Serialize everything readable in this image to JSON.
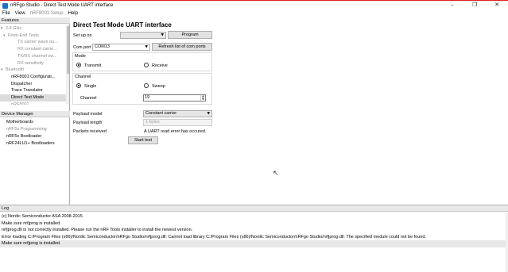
{
  "window": {
    "title": "nRFgo Studio - Direct Test Mode UART interface",
    "controls": [
      "–",
      "❐",
      "✕"
    ]
  },
  "menu": {
    "file": "File",
    "view": "View",
    "setup": "nRF8001 Setup",
    "help": "Help"
  },
  "features": {
    "header": "Features",
    "items": [
      {
        "label": "2.4 GHz",
        "expander": "▾"
      },
      {
        "label": "Front-End Tests",
        "expander": "▾"
      },
      {
        "label": "TX carrier wave ou..."
      },
      {
        "label": "RX constant carrie..."
      },
      {
        "label": "TX/RX channel sw..."
      },
      {
        "label": "RX sensitivity"
      },
      {
        "label": "Bluetooth",
        "expander": "▾"
      },
      {
        "label": "nRF8001 Configurati..."
      },
      {
        "label": "Dispatcher"
      },
      {
        "label": "Trace Translator"
      },
      {
        "label": "Direct Test Mode"
      },
      {
        "label": "nRF8002..."
      }
    ]
  },
  "device_manager": {
    "header": "Device Manager",
    "items": [
      {
        "label": "Motherboards"
      },
      {
        "label": "nRF5x Programming"
      },
      {
        "label": "nRF5x Bootloader"
      },
      {
        "label": "nRF24LU1+ Bootloaders"
      }
    ]
  },
  "dtm": {
    "title": "Direct Test Mode UART interface",
    "setup_label": "Set up on",
    "setup_value": "",
    "program_button": "Program",
    "com_port_label": "Com port",
    "com_port_value": "COM13",
    "refresh_button": "Refresh list of com ports",
    "mode_label": "Mode",
    "mode_transmit": "Transmit",
    "mode_receive": "Receive",
    "channel_group_label": "Channel",
    "channel_single": "Single",
    "channel_sweep": "Sweep",
    "channel_label": "Channel",
    "channel_value": "19",
    "payload_model_label": "Payload model",
    "payload_model_value": "Constant carrier",
    "payload_length_label": "Payload length",
    "payload_length_value": "1 bytes",
    "packets_received_label": "Packets received",
    "packets_received_value": "A UART read error has occured.",
    "start_button": "Start test"
  },
  "log": {
    "header": "Log",
    "lines": [
      "(c) Nordic Semiconductor ASA 2008-2015",
      "Make sure nrfjprog is installed.",
      "nrfjprog.dll is not correctly installed. Please run the nRF Tools installer to install the newest version.",
      "Error loading C:/Program Files (x86)/Nordic Semiconductor/nRFgo Studio/nrfjprog.dll: Cannot load library C:/Program Files (x86)/Nordic Semiconductor/nRFgo Studio/nrfjprog.dll: The specified module could not be found.",
      "Make sure nrfjprog is installed."
    ]
  }
}
